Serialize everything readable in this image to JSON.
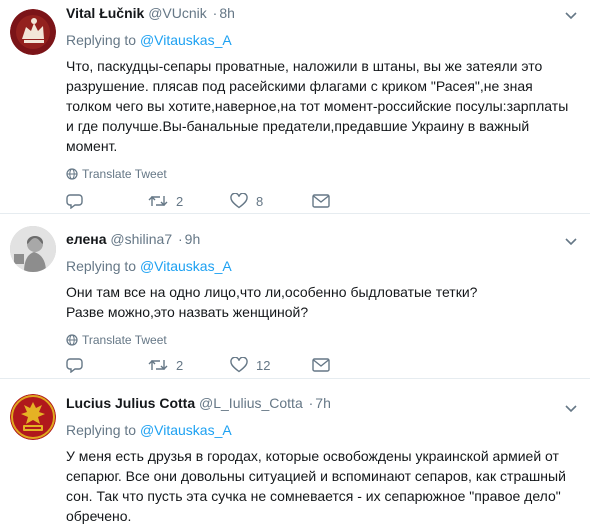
{
  "tweets": [
    {
      "fullname": "Vital Łučnik",
      "handle": "@VUcnik",
      "time": "8h",
      "replying_prefix": "Replying to",
      "replying_to": "@Vitauskas_A",
      "text": "Что, паскудцы-сепары проватные, наложили в штаны, вы же затеяли это разрушение. плясав под расейскими флагами с криком \"Расея\",не зная толком чего вы хотите,наверное,на тот момент-российские посулы:зарплаты и где получше.Вы-банальные предатели,предавшие Украину в важный момент.",
      "translate_label": "Translate Tweet",
      "reply_count": "",
      "retweet_count": "2",
      "like_count": "8"
    },
    {
      "fullname": "елена",
      "handle": "@shilina7",
      "time": "9h",
      "replying_prefix": "Replying to",
      "replying_to": "@Vitauskas_A",
      "text": "Они там все на одно лицо,что ли,особенно быдловатые тетки? Разве можно,это назвать женщиной?",
      "translate_label": "Translate Tweet",
      "reply_count": "",
      "retweet_count": "2",
      "like_count": "12"
    },
    {
      "fullname": "Lucius Julius Cotta",
      "handle": "@L_Iulius_Cotta",
      "time": "7h",
      "replying_prefix": "Replying to",
      "replying_to": "@Vitauskas_A",
      "text": "У меня есть друзья в городах, которые освобождены украинской армией от сепарюг. Все они довольны ситуацией и вспоминают сепаров, как страшный сон. Так что пусть эта сучка не сомневается - их сепарюжное \"правое дело\" обречено."
    }
  ],
  "icons": {
    "reply": "reply-icon",
    "retweet": "retweet-icon",
    "like": "heart-icon",
    "dm": "envelope-icon",
    "globe": "globe-icon",
    "caret": "chevron-down-icon"
  },
  "colors": {
    "link": "#1da1f2",
    "secondary": "#657786",
    "text": "#14171a",
    "border": "#e6ecf0"
  }
}
